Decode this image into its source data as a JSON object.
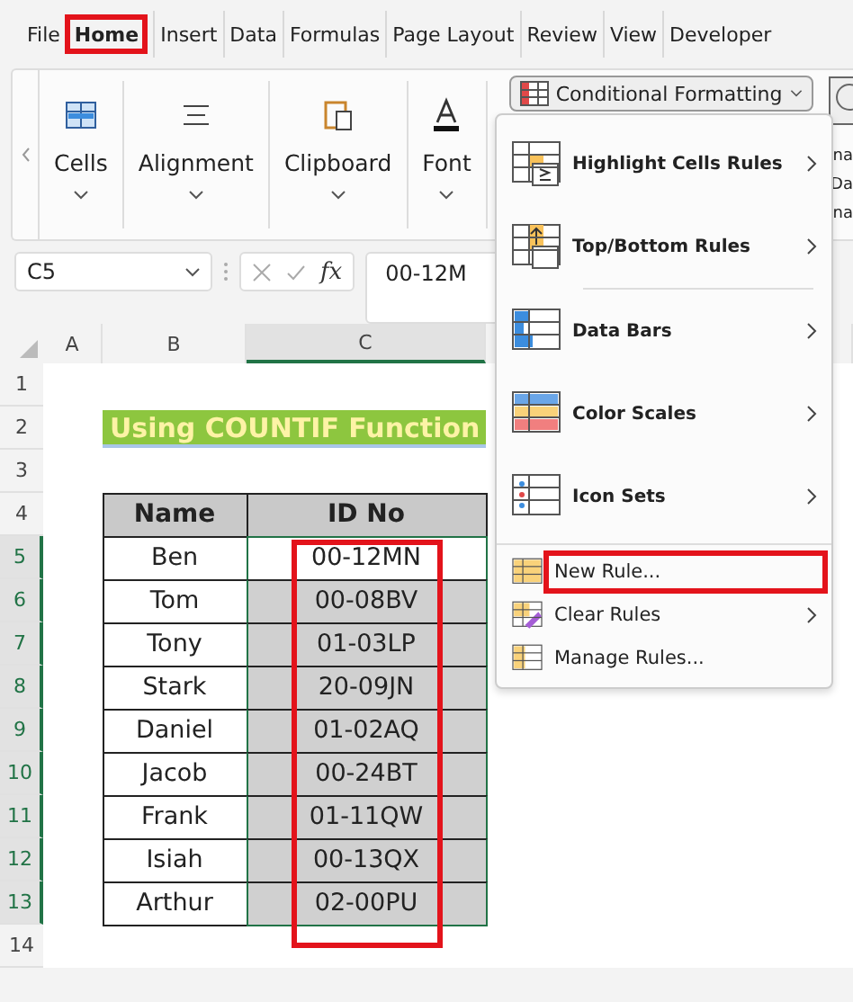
{
  "tabs": [
    {
      "label": "File",
      "selected": false
    },
    {
      "label": "Home",
      "selected": true
    },
    {
      "label": "Insert",
      "selected": false
    },
    {
      "label": "Data",
      "selected": false
    },
    {
      "label": "Formulas",
      "selected": false
    },
    {
      "label": "Page Layout",
      "selected": false
    },
    {
      "label": "Review",
      "selected": false
    },
    {
      "label": "View",
      "selected": false
    },
    {
      "label": "Developer",
      "selected": false
    }
  ],
  "ribbon": {
    "groups": [
      {
        "kind": "cells",
        "label": "Cells"
      },
      {
        "kind": "align",
        "label": "Alignment"
      },
      {
        "kind": "clip",
        "label": "Clipboard"
      },
      {
        "kind": "font",
        "label": "Font"
      }
    ],
    "conditional_formatting": "Conditional Formatting",
    "cut_group": [
      "na",
      "Da",
      "na"
    ]
  },
  "formula_bar": {
    "name_box": "C5",
    "fx": "fx",
    "value": "00-12M"
  },
  "sheet": {
    "columns": [
      {
        "label": "A",
        "selected": false
      },
      {
        "label": "B",
        "selected": false
      },
      {
        "label": "C",
        "selected": true
      }
    ],
    "row_numbers": [
      "1",
      "2",
      "3",
      "4",
      "5",
      "6",
      "7",
      "8",
      "9",
      "10",
      "11",
      "12",
      "13",
      "14"
    ],
    "title": "Using COUNTIF Function",
    "headers": [
      "Name",
      "ID No"
    ],
    "rows": [
      {
        "name": "Ben",
        "id": "00-12MN",
        "active": true
      },
      {
        "name": "Tom",
        "id": "00-08BV",
        "active": false
      },
      {
        "name": "Tony",
        "id": "01-03LP",
        "active": false
      },
      {
        "name": "Stark",
        "id": "20-09JN",
        "active": false
      },
      {
        "name": "Daniel",
        "id": "01-02AQ",
        "active": false
      },
      {
        "name": "Jacob",
        "id": "00-24BT",
        "active": false
      },
      {
        "name": "Frank",
        "id": "01-11QW",
        "active": false
      },
      {
        "name": "Isiah",
        "id": "00-13QX",
        "active": false
      },
      {
        "name": "Arthur",
        "id": "02-00PU",
        "active": false
      }
    ]
  },
  "menu": {
    "items": [
      {
        "kind": "highlight",
        "label": "Highlight Cells Rules",
        "submenu": true,
        "marked": false
      },
      {
        "kind": "topbottom",
        "label": "Top/Bottom Rules",
        "submenu": true,
        "marked": false
      },
      {
        "kind": "databars",
        "label": "Data Bars",
        "submenu": true,
        "marked": false
      },
      {
        "kind": "colorscales",
        "label": "Color Scales",
        "submenu": true,
        "marked": false
      },
      {
        "kind": "iconsets",
        "label": "Icon Sets",
        "submenu": true,
        "marked": false
      },
      {
        "kind": "new",
        "label": "New Rule...",
        "submenu": false,
        "marked": true
      },
      {
        "kind": "clear",
        "label": "Clear Rules",
        "submenu": true,
        "marked": false
      },
      {
        "kind": "manage",
        "label": "Manage Rules...",
        "submenu": false,
        "marked": false
      }
    ]
  }
}
